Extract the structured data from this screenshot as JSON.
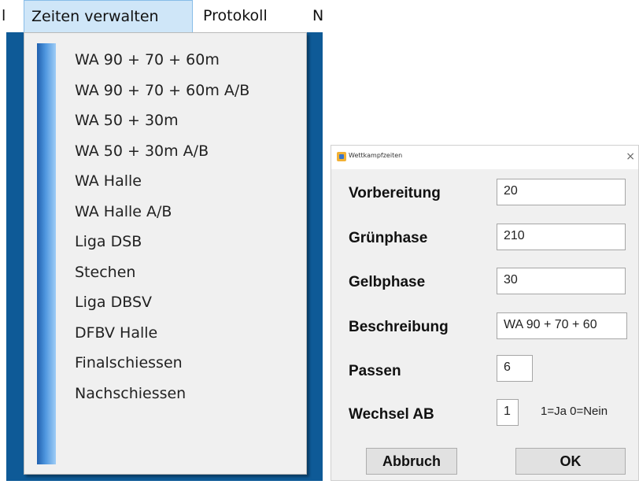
{
  "menubar": {
    "left_partial": "l",
    "zeiten": "Zeiten verwalten",
    "protokoll": "Protokoll",
    "next_partial": "N"
  },
  "dropdown": {
    "items": [
      "WA 90 + 70 + 60m",
      "WA 90 + 70 + 60m A/B",
      "WA 50 + 30m",
      "WA 50 + 30m A/B",
      "WA Halle",
      "WA Halle A/B",
      "Liga DSB",
      "Stechen",
      "Liga DBSV",
      "DFBV Halle",
      "Finalschiessen",
      "Nachschiessen"
    ]
  },
  "dialog": {
    "title": "Wettkampfzeiten",
    "close_glyph": "×",
    "labels": {
      "vorbereitung": "Vorbereitung",
      "gruenphase": "Grünphase",
      "gelbphase": "Gelbphase",
      "beschreibung": "Beschreibung",
      "passen": "Passen",
      "wechsel": "Wechsel AB"
    },
    "values": {
      "vorbereitung": "20",
      "gruenphase": "210",
      "gelbphase": "30",
      "beschreibung": "WA 90 + 70 + 60",
      "passen": "6",
      "wechsel": "1"
    },
    "wechsel_hint": "1=Ja 0=Nein",
    "buttons": {
      "abbruch": "Abbruch",
      "ok": "OK"
    }
  },
  "colors": {
    "desktop_bg": "#0e5a97",
    "menu_highlight": "#cfe6f8",
    "menu_bg": "#f0f0f0"
  }
}
